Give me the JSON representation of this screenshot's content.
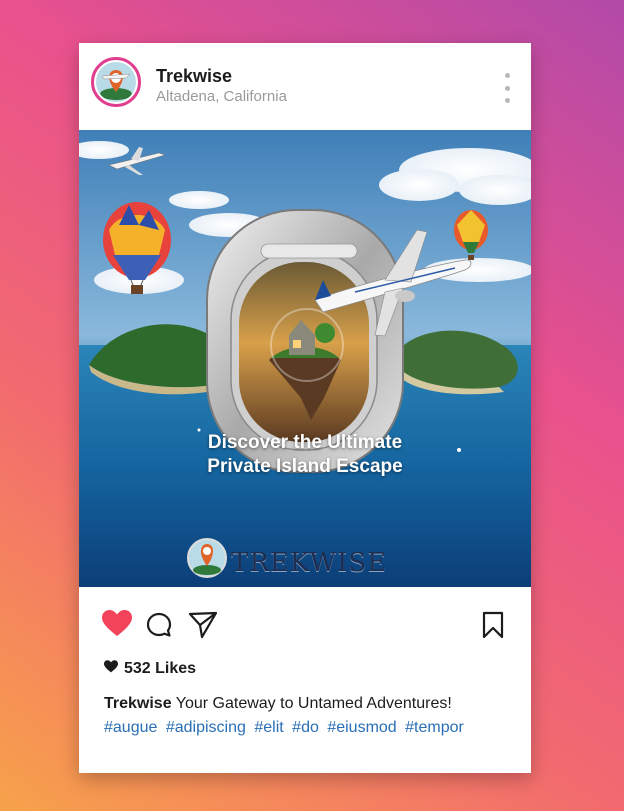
{
  "post": {
    "username": "Trekwise",
    "location": "Altadena, California",
    "image": {
      "headline_line1": "Discover the Ultimate",
      "headline_line2": "Private Island Escape",
      "brand_logo_text": "TREKWISE"
    },
    "likes_label": "532 Likes",
    "caption_user": "Trekwise",
    "caption_text": "Your Gateway to Untamed Adventures!",
    "hashtags": [
      "#augue",
      "#adipiscing",
      "#elit",
      "#do",
      "#eiusmod",
      "#tempor"
    ],
    "liked": true
  },
  "icons": {
    "more": "more-options-icon",
    "like": "heart-icon",
    "comment": "comment-icon",
    "share": "send-icon",
    "save": "bookmark-icon",
    "likes": "small-heart-icon"
  },
  "colors": {
    "like_active": "#f2435a",
    "hashtag": "#2a6fb5",
    "avatar_ring": "#e23e8f"
  }
}
